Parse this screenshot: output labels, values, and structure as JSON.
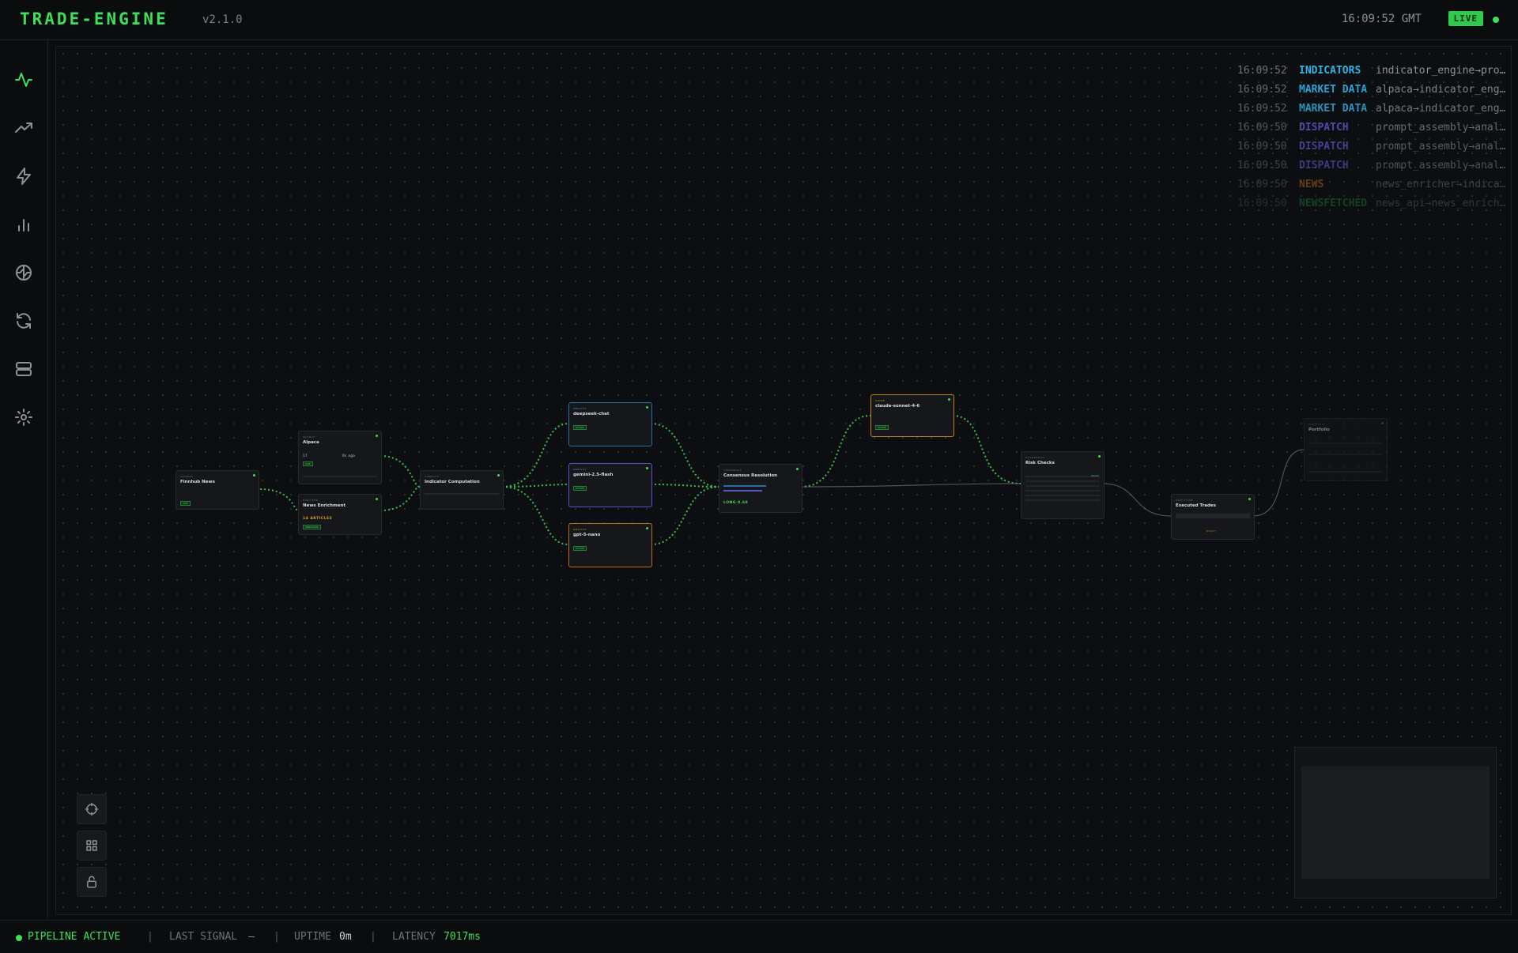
{
  "header": {
    "brand": "TRADE-ENGINE",
    "version": "v2.1.0",
    "clock": "16:09:52 GMT",
    "live_label": "LIVE"
  },
  "sidebar": {
    "items": [
      {
        "name": "activity-icon",
        "active": true
      },
      {
        "name": "trending-up-icon",
        "active": false
      },
      {
        "name": "lightning-icon",
        "active": false
      },
      {
        "name": "bar-chart-icon",
        "active": false
      },
      {
        "name": "brain-icon",
        "active": false
      },
      {
        "name": "refresh-icon",
        "active": false
      },
      {
        "name": "server-icon",
        "active": false
      },
      {
        "name": "gear-icon",
        "active": false
      }
    ]
  },
  "event_log": [
    {
      "time": "16:09:52",
      "category": "INDICATORS",
      "color": "#2ab6e8",
      "message": "indicator_engine→pro…"
    },
    {
      "time": "16:09:52",
      "category": "MARKET DATA",
      "color": "#2ab6e8",
      "message": "alpaca→indicator_eng…"
    },
    {
      "time": "16:09:52",
      "category": "MARKET DATA",
      "color": "#2ab6e8",
      "message": "alpaca→indicator_eng…"
    },
    {
      "time": "16:09:50",
      "category": "DISPATCH",
      "color": "#6b62e8",
      "message": "prompt_assembly→anal…"
    },
    {
      "time": "16:09:50",
      "category": "DISPATCH",
      "color": "#6b62e8",
      "message": "prompt_assembly→anal…"
    },
    {
      "time": "16:09:50",
      "category": "DISPATCH",
      "color": "#6b62e8",
      "message": "prompt_assembly→anal…"
    },
    {
      "time": "16:09:50",
      "category": "NEWS",
      "color": "#e0801f",
      "message": "news_enricher→indica…"
    },
    {
      "time": "16:09:50",
      "category": "NEWSFETCHED",
      "color": "#2fb54a",
      "message": "news_api→news_enrich…"
    }
  ],
  "pipeline": {
    "nodes": [
      {
        "type": "SOURCE",
        "name": "Finnhub News",
        "badge": "LIVE"
      },
      {
        "type": "SOURCE",
        "name": "Alpaca",
        "badge": "LIVE",
        "stat1": "17",
        "stat2": "0s ago"
      },
      {
        "type": "ENRICHER",
        "name": "News Enrichment",
        "detail": "14 ARTICLES",
        "badge": "ENRICHING"
      },
      {
        "type": "COMPUTE",
        "name": "Indicator Computation"
      },
      {
        "type": "ANALYST",
        "name": "deepseek-chat",
        "badge": "ACTIVE"
      },
      {
        "type": "ANALYST",
        "name": "gemini-2.5-flash",
        "badge": "ACTIVE"
      },
      {
        "type": "ANALYST",
        "name": "gpt-5-nano",
        "badge": "ACTIVE"
      },
      {
        "type": "CONSENSUS",
        "name": "Consensus Resolution",
        "detail": "LONG 0.68"
      },
      {
        "type": "JUDGE",
        "name": "claude-sonnet-4-6",
        "badge": "ACTIVE"
      },
      {
        "type": "GUARDRAILS",
        "name": "Risk Checks",
        "detail": "PASS"
      },
      {
        "type": "EXECUTION",
        "name": "Executed Trades",
        "badge": "READY"
      },
      {
        "type": "PORTFOLIO",
        "name": "Portfolio"
      }
    ]
  },
  "canvas_tools": [
    {
      "name": "recenter-icon"
    },
    {
      "name": "grid-icon"
    },
    {
      "name": "unlock-icon"
    }
  ],
  "status": {
    "pipeline_label": "PIPELINE ACTIVE",
    "separator": "|",
    "last_signal_label": "LAST SIGNAL",
    "last_signal_value": "—",
    "uptime_label": "UPTIME",
    "uptime_value": "0m",
    "latency_label": "LATENCY",
    "latency_value": "7017ms"
  }
}
